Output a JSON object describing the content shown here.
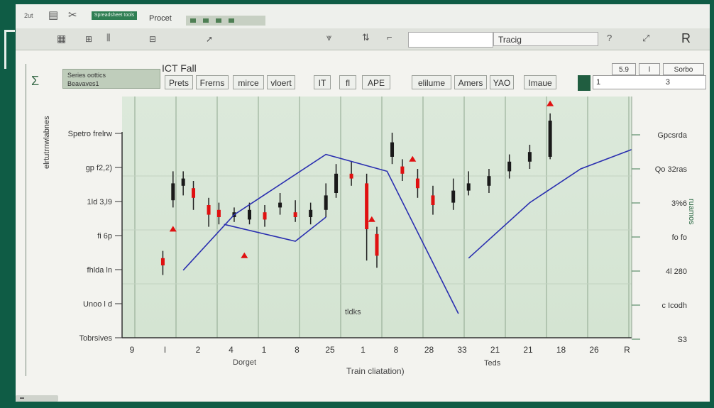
{
  "app": {
    "title_text": "Procet",
    "tab_label": "Spreadsheet tools",
    "search_value": "",
    "title_box": "Tracig",
    "right_letter": "R",
    "ribbon_left": "2ut",
    "ribbon_icons": [
      "save-icon",
      "cut-icon",
      "paste-icon",
      "format-icon",
      "grid-icon",
      "chart-icon"
    ],
    "accent_color": "#0f5c45",
    "bar_color": "#2f7e53"
  },
  "toolbar": {
    "series_box_line1": "Series oottics",
    "series_box_line2": "Beavaves1",
    "label_ict": "ICT Fall",
    "buttons": [
      "Prets",
      "Frerns",
      "mirce",
      "vloert",
      "IT",
      "fl",
      "APE",
      "elilume",
      "Amers",
      "YAO",
      "Imaue"
    ],
    "small_box_1": "5.9",
    "small_box_2": "l",
    "small_box_3": "Sorbo",
    "value_box": "3",
    "value_box_prefix": "1"
  },
  "chart_data": {
    "type": "line",
    "title": "",
    "xlabel": "Train cliatation)",
    "ylabel": "elrtutrnwlabnes",
    "ylabel_right": "ruamos",
    "extra_label_x_left": "Dorget",
    "extra_label_x_right": "Teds",
    "mid_label": "tldks",
    "ylim": [
      0,
      10
    ],
    "xlim": [
      0,
      100
    ],
    "y_ticks_left": [
      "Spetro frelrw",
      "gp f2,2)",
      "1ld 3,l9",
      "fi 6p",
      "fhlda ln",
      "Unoo l d",
      "Tobrsives"
    ],
    "y_ticks_right": [
      "Gpcsrda",
      "Qo 32ras",
      "3%6",
      "fo fo",
      "4l 280",
      "c Icodh",
      "S3"
    ],
    "x_ticks": [
      "9",
      "l",
      "2",
      "4",
      "1",
      "8",
      "25",
      "1",
      "8",
      "28",
      "33",
      "21",
      "21",
      "18",
      "26",
      "R"
    ],
    "candle_series": {
      "name": "",
      "up_color": "#1a1a1a",
      "down_color": "#e01010",
      "points": [
        {
          "x": 8,
          "o": 3.3,
          "c": 3.0,
          "h": 3.6,
          "l": 2.6
        },
        {
          "x": 10,
          "o": 5.7,
          "c": 6.4,
          "h": 6.9,
          "l": 5.4
        },
        {
          "x": 12,
          "o": 6.3,
          "c": 6.6,
          "h": 6.9,
          "l": 5.9
        },
        {
          "x": 14,
          "o": 6.2,
          "c": 5.8,
          "h": 6.5,
          "l": 5.3
        },
        {
          "x": 17,
          "o": 5.5,
          "c": 5.1,
          "h": 5.8,
          "l": 4.6
        },
        {
          "x": 19,
          "o": 5.3,
          "c": 5.0,
          "h": 5.6,
          "l": 4.7
        },
        {
          "x": 22,
          "o": 5.0,
          "c": 5.2,
          "h": 5.4,
          "l": 4.8
        },
        {
          "x": 25,
          "o": 4.9,
          "c": 5.3,
          "h": 5.6,
          "l": 4.7
        },
        {
          "x": 28,
          "o": 5.2,
          "c": 4.9,
          "h": 5.5,
          "l": 4.6
        },
        {
          "x": 31,
          "o": 5.4,
          "c": 5.6,
          "h": 6.0,
          "l": 5.1
        },
        {
          "x": 34,
          "o": 5.2,
          "c": 5.0,
          "h": 5.7,
          "l": 4.8
        },
        {
          "x": 37,
          "o": 5.0,
          "c": 5.3,
          "h": 5.6,
          "l": 4.7
        },
        {
          "x": 40,
          "o": 5.3,
          "c": 5.9,
          "h": 6.4,
          "l": 5.0
        },
        {
          "x": 42,
          "o": 6.0,
          "c": 6.8,
          "h": 7.2,
          "l": 5.8
        },
        {
          "x": 45,
          "o": 6.8,
          "c": 6.6,
          "h": 7.3,
          "l": 6.3
        },
        {
          "x": 48,
          "o": 6.4,
          "c": 4.5,
          "h": 6.8,
          "l": 3.2
        },
        {
          "x": 50,
          "o": 4.3,
          "c": 3.4,
          "h": 4.6,
          "l": 2.9
        },
        {
          "x": 53,
          "o": 7.5,
          "c": 8.1,
          "h": 8.5,
          "l": 7.2
        },
        {
          "x": 55,
          "o": 7.1,
          "c": 6.8,
          "h": 7.4,
          "l": 6.5
        },
        {
          "x": 58,
          "o": 6.6,
          "c": 6.2,
          "h": 7.0,
          "l": 5.8
        },
        {
          "x": 61,
          "o": 5.9,
          "c": 5.5,
          "h": 6.3,
          "l": 5.1
        },
        {
          "x": 65,
          "o": 5.6,
          "c": 6.1,
          "h": 6.6,
          "l": 5.3
        },
        {
          "x": 68,
          "o": 6.1,
          "c": 6.4,
          "h": 6.9,
          "l": 5.9
        },
        {
          "x": 72,
          "o": 6.3,
          "c": 6.7,
          "h": 7.0,
          "l": 6.0
        },
        {
          "x": 76,
          "o": 6.9,
          "c": 7.3,
          "h": 7.6,
          "l": 6.6
        },
        {
          "x": 80,
          "o": 7.3,
          "c": 7.7,
          "h": 8.0,
          "l": 7.0
        },
        {
          "x": 84,
          "o": 7.5,
          "c": 9.0,
          "h": 9.3,
          "l": 7.4
        }
      ]
    },
    "line_series": {
      "name": "",
      "color": "#2a2fb0",
      "points": [
        [
          12,
          2.8
        ],
        [
          22,
          5.1
        ],
        [
          40,
          7.6
        ],
        [
          52,
          6.9
        ],
        [
          66,
          1.0
        ]
      ]
    },
    "line_series_2": {
      "name": "",
      "color": "#2a2fb0",
      "points": [
        [
          20,
          4.7
        ],
        [
          30,
          4.2
        ],
        [
          34,
          4.0
        ],
        [
          40,
          5.0
        ]
      ]
    },
    "trend_series": {
      "name": "",
      "color": "#2a2fb0",
      "points": [
        [
          68,
          3.3
        ],
        [
          80,
          5.6
        ],
        [
          90,
          7.0
        ],
        [
          100,
          7.8
        ]
      ]
    },
    "marker_points": [
      [
        10,
        4.4
      ],
      [
        24,
        3.3
      ],
      [
        49,
        4.8
      ],
      [
        57,
        7.3
      ],
      [
        84,
        9.6
      ]
    ],
    "grid": true,
    "legend": "none"
  }
}
